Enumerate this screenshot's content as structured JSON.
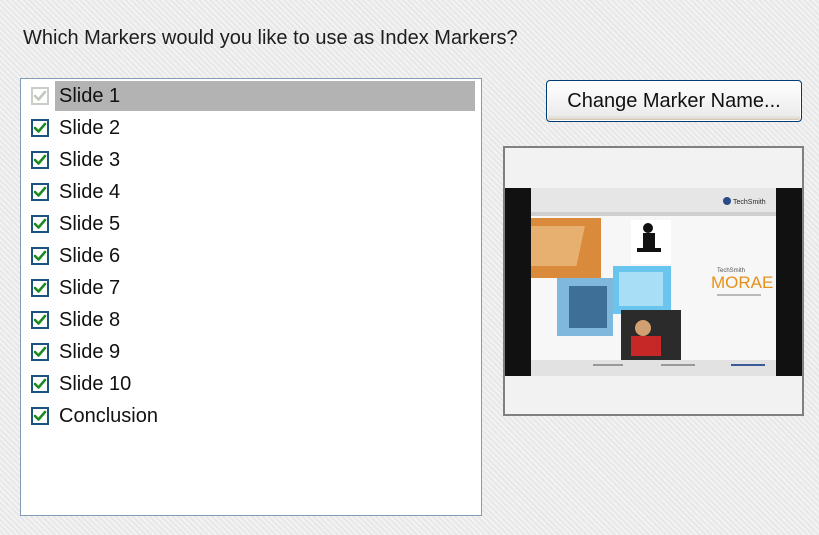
{
  "prompt": "Which Markers would you like to use as Index Markers?",
  "change_button_label": "Change Marker Name...",
  "markers": [
    {
      "label": "Slide 1",
      "checked": true,
      "disabled": true,
      "selected": true
    },
    {
      "label": "Slide 2",
      "checked": true
    },
    {
      "label": "Slide 3",
      "checked": true
    },
    {
      "label": "Slide 4",
      "checked": true
    },
    {
      "label": "Slide 5",
      "checked": true
    },
    {
      "label": "Slide 6",
      "checked": true
    },
    {
      "label": "Slide 7",
      "checked": true
    },
    {
      "label": "Slide 8",
      "checked": true
    },
    {
      "label": "Slide 9",
      "checked": true
    },
    {
      "label": "Slide 10",
      "checked": true
    },
    {
      "label": "Conclusion",
      "checked": true
    }
  ],
  "preview": {
    "brand_small": "TechSmith",
    "brand_logo": "TechSmith",
    "product_title": "MORAE"
  },
  "colors": {
    "check_enabled": "#1e8a1e",
    "check_disabled": "#c0c8bc",
    "selection": "#b3b3b3",
    "brand_orange": "#e8901a"
  }
}
